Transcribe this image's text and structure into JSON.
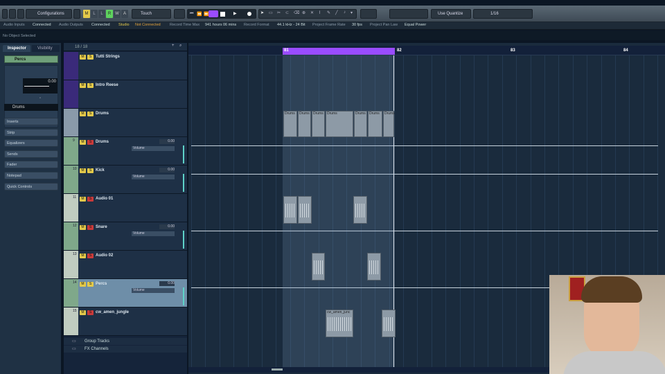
{
  "toolbar": {
    "configurations": "Configurations",
    "automation_buttons": [
      "M",
      "L",
      "R",
      "W",
      "A"
    ],
    "automation_mode": "Touch",
    "quantize": "Use Quantize",
    "grid": "1/16"
  },
  "infobar": {
    "audio_inputs": "Audio Inputs",
    "audio_inputs_status": "Connected",
    "audio_outputs": "Audio Outputs",
    "audio_outputs_status": "Connected",
    "studio": "Studio",
    "studio_status": "Not Connected",
    "record_time_max": "Record Time Max",
    "record_time_value": "941 hours 06 mins",
    "record_format": "Record Format",
    "record_format_value": "44.1 kHz - 24 Bit",
    "frame_rate": "Project Frame Rate",
    "frame_rate_value": "30 fps",
    "pan_law": "Project Pan Law",
    "pan_law_value": "Equal Power"
  },
  "status": "No Object Selected",
  "inspector": {
    "tab_inspector": "Inspector",
    "tab_visibility": "Visibility",
    "track_name": "Percs",
    "volume": "0.00",
    "output": "Drums",
    "sections": [
      "Inserts",
      "Strip",
      "Equalizers",
      "Sends",
      "Fader",
      "Notepad",
      "Quick Controls"
    ]
  },
  "tracklist": {
    "counter": "18 / 18",
    "tracks": [
      {
        "num": "",
        "name": "Tutti Strings",
        "color": "#3a2a7a",
        "value": ""
      },
      {
        "num": "",
        "name": "Intro Reese",
        "color": "#3a2a7a",
        "value": ""
      },
      {
        "num": "",
        "name": "Drums",
        "color": "#8a9aaa",
        "value": ""
      },
      {
        "num": "9",
        "name": "Drums",
        "color": "#7fa88a",
        "value": "0.00"
      },
      {
        "num": "10",
        "name": "Kick",
        "color": "#7fa88a",
        "value": "0.00"
      },
      {
        "num": "11",
        "name": "Audio 01",
        "color": "#c0ccc0",
        "value": ""
      },
      {
        "num": "12",
        "name": "Snare",
        "color": "#7fa88a",
        "value": "0.00"
      },
      {
        "num": "13",
        "name": "Audio 02",
        "color": "#c0ccc0",
        "value": ""
      },
      {
        "num": "14",
        "name": "Percs",
        "color": "#7fa88a",
        "value": "0.00"
      },
      {
        "num": "15",
        "name": "cw_amen_jungle",
        "color": "#c0ccc0",
        "value": ""
      }
    ],
    "volume_label": "Volume",
    "group_tracks": "Group Tracks",
    "fx_channels": "FX Channels"
  },
  "ruler": {
    "bars": [
      "81",
      "82",
      "83",
      "84"
    ]
  },
  "events": {
    "drums_labels": [
      "Drums",
      "Drums",
      "Drums",
      "Drums",
      "Drums",
      "Drums",
      "Drums"
    ],
    "amen_label": "cw_amen_junc"
  },
  "colors": {
    "range": "#9a4cff",
    "accent_yellow": "#e3c94a",
    "accent_green": "#5ed35e"
  }
}
